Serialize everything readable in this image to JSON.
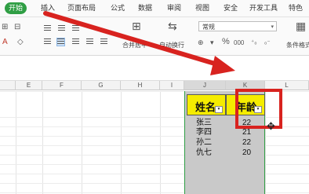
{
  "menu": {
    "tabs": [
      "开始",
      "插入",
      "页面布局",
      "公式",
      "数据",
      "审阅",
      "视图",
      "安全",
      "开发工具",
      "特色"
    ]
  },
  "ribbon": {
    "number_format": "常规",
    "merge_center": "合并居中",
    "wrap_text": "自动换行",
    "conditional_format": "条件格式",
    "percent_symbol": "%",
    "thousands_symbol": "000",
    "font_color_label": "A"
  },
  "columns": [
    "E",
    "F",
    "G",
    "H",
    "I",
    "J",
    "K",
    "L"
  ],
  "table": {
    "headers": [
      "姓名",
      "年龄"
    ],
    "rows": [
      [
        "张三",
        "22"
      ],
      [
        "李四",
        "21"
      ],
      [
        "孙二",
        "22"
      ],
      [
        "仇七",
        "20"
      ]
    ]
  },
  "colors": {
    "accent_green": "#2f9e44",
    "header_yellow": "#f5ec00",
    "highlight_red": "#d8231f"
  }
}
